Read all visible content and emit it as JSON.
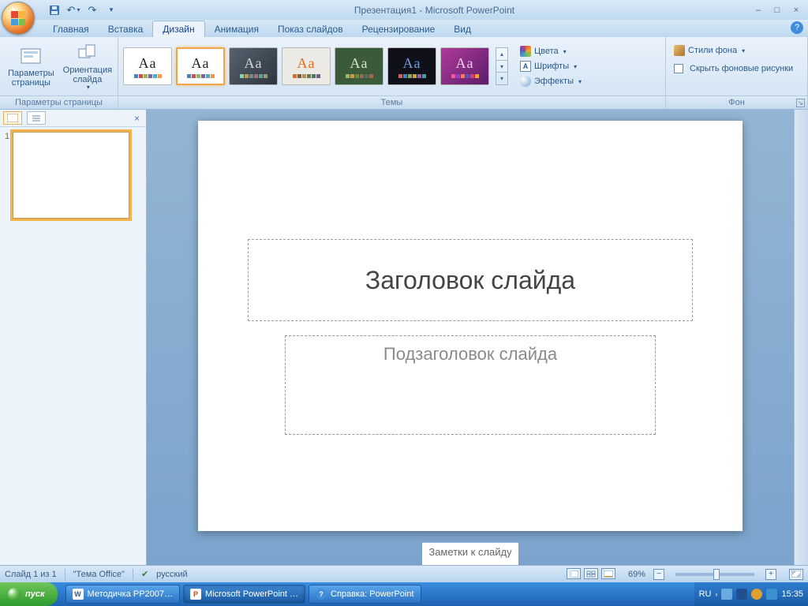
{
  "title_doc": "Презентация1",
  "title_app": "Microsoft PowerPoint",
  "qat": {
    "save": "save-icon",
    "undo": "undo-icon",
    "redo": "redo-icon"
  },
  "tabs": [
    "Главная",
    "Вставка",
    "Дизайн",
    "Анимация",
    "Показ слайдов",
    "Рецензирование",
    "Вид"
  ],
  "active_tab": 2,
  "ribbon": {
    "page_params": {
      "page_setup": "Параметры\nстраницы",
      "orientation": "Ориентация\nслайда",
      "group_label": "Параметры страницы"
    },
    "themes": {
      "group_label": "Темы",
      "colors": "Цвета",
      "fonts": "Шрифты",
      "effects": "Эффекты"
    },
    "background": {
      "styles": "Стили фона",
      "hide_graphics": "Скрыть фоновые рисунки",
      "group_label": "Фон"
    }
  },
  "slide": {
    "number": "1",
    "title_placeholder": "Заголовок слайда",
    "subtitle_placeholder": "Подзаголовок слайда",
    "notes_placeholder": "Заметки к слайду"
  },
  "statusbar": {
    "slide_info": "Слайд 1 из 1",
    "theme_name": "\"Тема Office\"",
    "language": "русский",
    "zoom": "69%"
  },
  "taskbar": {
    "start": "пуск",
    "items": [
      "Методичка PP2007…",
      "Microsoft PowerPoint …",
      "Справка: PowerPoint"
    ],
    "lang": "RU",
    "clock": "15:35"
  }
}
